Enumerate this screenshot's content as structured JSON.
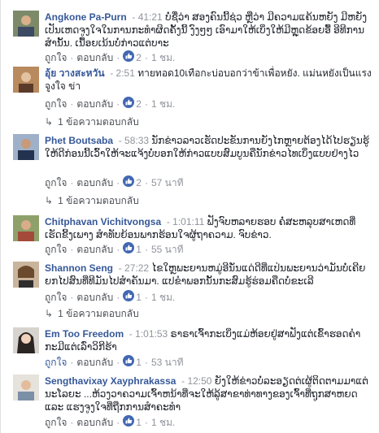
{
  "labels": {
    "like": "ถูกใจ",
    "reply": "ตอบกลับ",
    "separator": "·"
  },
  "comments": [
    {
      "name": "Angkone Pa-Purn",
      "time": "41:21",
      "text": "ບໍ່ຊື່ວ່າ ສອງຄົນນີ້ຊ່ວ ຫຼືວ່າ ມີຄວາມແຄ້ນຫຍັງ ມີຫຍັງເປັນເຫດຈູງໃຈໃນການກະທໍາຜິດຄັ້ງນີ້ ງົງໆໆ ເອົາມາໃຫ້ເບິ່ງໃຫ້ມີຫຼຸດຂ້ອຍອື້ ອີທີການສຳນັ້ນ. ເນື້ອຍເນ້ນບໍ່ກ່າວແຕ່ບາະ",
      "reactions": "2",
      "age": "1 ชม."
    },
    {
      "name": "อุ้ย วางสะหวัน",
      "time": "2:51",
      "text": "ทายทอด10เทือกะบ่อบอกว่าข้าเพื่อหยัง. แม่นหยังเป็นแรงจูงใจ ข่า",
      "reactions": "2",
      "age": "1 ชม.",
      "replies": "1 ข้อความตอบกลับ"
    },
    {
      "name": "Phet Boutsaba",
      "time": "58:33",
      "text": "ນັກຂ່າວລາວເຮັດປະຂັນການຍັງໄກຫຼາຍຕ້ອງໄດ້ໄປຮຽນຮູ້ໃຫ້ດີກ່ອນນີ້ເວົ້າໃຫ້ຈະແຈ້ງບໍ່ບອກໃຫ້ກ່າວແບບສົມບູນຄືນັກຂ່າວໄທເບິ່ງແບບຢ່າງໄວ",
      "reactions": "2",
      "age": "57 นาที",
      "replies": "1 ข้อความตอบกลับ"
    },
    {
      "name": "Chitphavan Vichitvongsa",
      "time": "1:01:11",
      "text": "ຟັງຈົບຫລາຍຮອບ ຄໍ່ສະຫລຸບສາເຫດທີ່ ເຮັດຂີ້ງເພາງ ສໍາທັບຍ້ອນພາກຮ້ອນໃຈຜູ້ຖາຄວາມ. ຈົບຂ່າວ.",
      "reactions": "1",
      "age": "55 นาที"
    },
    {
      "name": "Shannon Seng",
      "time": "27:22",
      "text": "ໄຂໃຫຼພະຍານຫມູ່ອີນັ່ນແດ່ດີທີ່ແປ່ນພະຍານວ່າມັນບໍ່ເຄີຍຍກໄປສົນທີ່ທີມັນໄປສຳຄັນມາ. ແປຂໍາພອກນັ້ນກະສົມຮູ້ຮ່ອມຄືດບໍ່ຂະເລີ",
      "reactions": "1",
      "age": "1 ชม.",
      "replies": "1 ข้อความตอบกลับ"
    },
    {
      "name": "Em Too Freedom",
      "time": "1:01:53",
      "text": "ຣາຣາເຈົ້າກະເບິ່ງແມ່ຫ້ອຍຢູ່ສາຟັງແຕ່ເຂົ້າຮອດຄໍາກະມີແຕ່ເລົ່າວິກີຮ້າ",
      "reactions": "1",
      "age": "53 นาที",
      "liked": true
    },
    {
      "name": "Sengthavixay Xayphrakassa",
      "time": "12:50",
      "text": "ຍັງໃຫ້ຂ່າວບໍ່ລະອຽດຕ່ເຜູ້ຕິດຕາມມາແຕ່ນະໂລຍະ ...ຫ້ວງວາຄວາມເຈົ້າຫນ້າທີ່ຈະໃຫ້ລູ້ສາຂາທ່າທາງຂອງເຈົ້າທີ່ຖູກສາຫຍດແລະ ແຮງຈູງໃຈທີ່ຖືກການສຳຄະທໍາ",
      "reactions": "1",
      "age": "1 ชม."
    }
  ]
}
